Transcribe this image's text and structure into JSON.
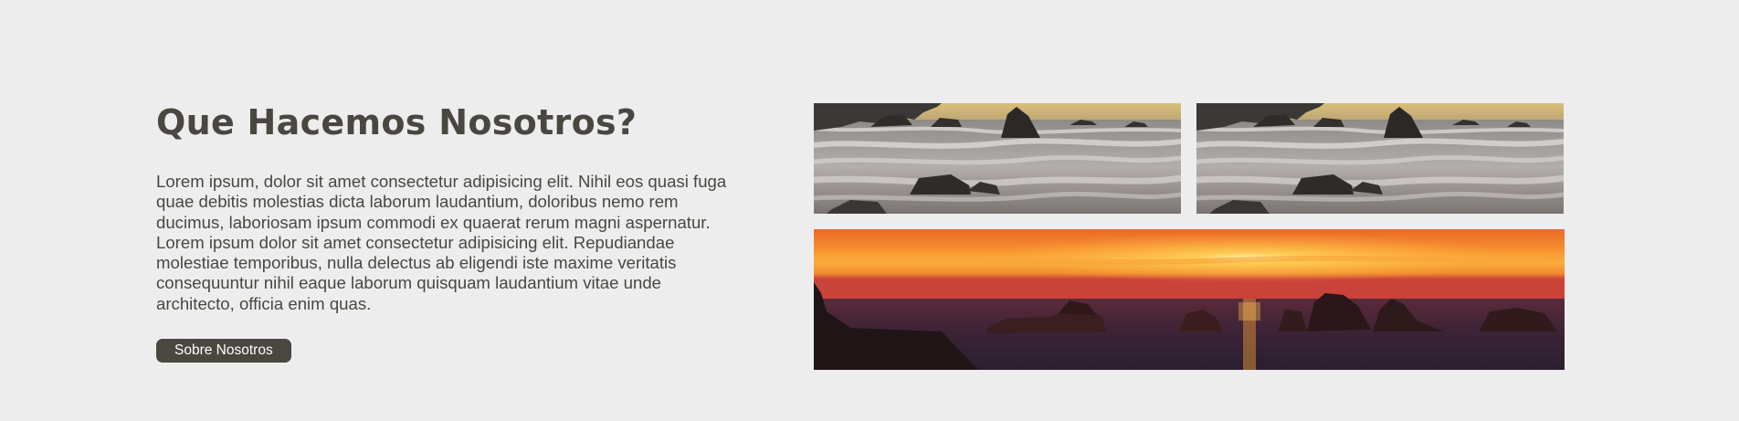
{
  "about": {
    "title": "Que Hacemos Nosotros?",
    "paragraph": "Lorem ipsum, dolor sit amet consectetur adipisicing elit. Nihil eos quasi fuga quae debitis molestias dicta laborum laudantium, doloribus nemo rem ducimus, laboriosam ipsum commodi ex quaerat rerum magni aspernatur. Lorem ipsum dolor sit amet consectetur adipisicing elit. Repudiandae molestiae temporibus, nulla delectus ab eligendi iste maxime veritatis consequuntur nihil eaque laborum quisquam laudantium vitae unde architecto, officia enim quas.",
    "button_label": "Sobre Nosotros"
  },
  "colors": {
    "background": "#ededed",
    "text": "#4a4741",
    "button_bg": "#4a4741",
    "button_text": "#ffffff"
  },
  "gallery": {
    "images": [
      {
        "subject": "rocky beach with waves"
      },
      {
        "subject": "rocky beach with waves"
      },
      {
        "subject": "sunset over the sea with rocks"
      }
    ]
  }
}
